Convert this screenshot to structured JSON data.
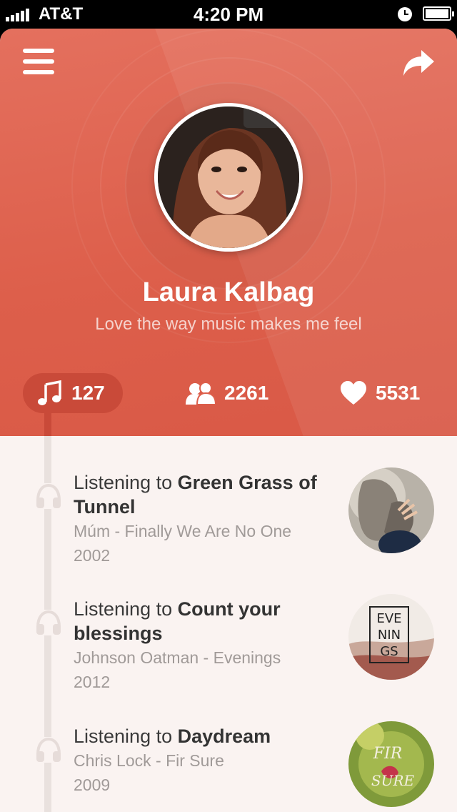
{
  "status_bar": {
    "carrier": "AT&T",
    "time": "4:20 PM"
  },
  "profile": {
    "name": "Laura Kalbag",
    "tagline": "Love the way music makes me feel"
  },
  "stats": {
    "songs": "127",
    "friends": "2261",
    "likes": "5531"
  },
  "feed": [
    {
      "prefix": "Listening to ",
      "track": "Green Grass of Tunnel",
      "artist_album": "Múm - Finally We Are No One",
      "year": "2002"
    },
    {
      "prefix": "Listening to ",
      "track": "Count your blessings",
      "artist_album": "Johnson Oatman  - Evenings",
      "year": "2012",
      "cover_text": [
        "EVE",
        "NIN",
        "GS"
      ]
    },
    {
      "prefix": "Listening to ",
      "track": "Daydream",
      "artist_album": "Chris Lock - Fir Sure",
      "year": "2009",
      "cover_text": [
        "FIR",
        "SURE"
      ]
    }
  ],
  "colors": {
    "accent": "#dd5f4b",
    "accent_dark": "#c94a39",
    "background": "#faf3f1"
  },
  "icons": [
    "signal-icon",
    "clock-icon",
    "battery-icon",
    "menu-icon",
    "share-icon",
    "music-note-icon",
    "friends-icon",
    "heart-icon",
    "headphones-icon"
  ]
}
